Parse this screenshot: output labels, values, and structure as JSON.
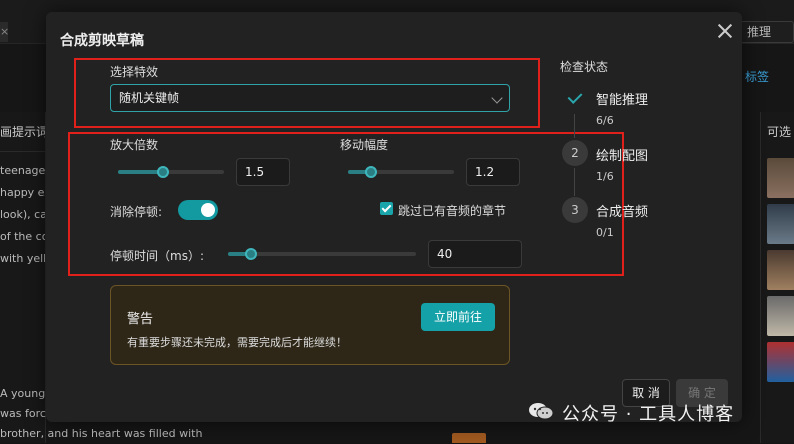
{
  "background": {
    "tab_left": "×",
    "btn_right": "推理",
    "link_right": "标签",
    "left_col": {
      "header": "画提示词",
      "lines": [
        "teenager",
        "happy ex",
        "look), cas",
        "of the co",
        "with yello"
      ]
    },
    "bottom_text": [
      "A young",
      "was force",
      "brother, and his heart was filled with"
    ],
    "right_col_header": "可选"
  },
  "modal": {
    "title": "合成剪映草稿",
    "effect": {
      "label": "选择特效",
      "value": "随机关键帧"
    },
    "zoom": {
      "label": "放大倍数",
      "value": "1.5",
      "fraction": 0.42
    },
    "move": {
      "label": "移动幅度",
      "value": "1.2",
      "fraction": 0.22
    },
    "remove_pause": {
      "label": "消除停顿:",
      "on": true
    },
    "skip_audio": {
      "label": "跳过已有音频的章节",
      "checked": true
    },
    "pause_time": {
      "label": "停顿时间（ms）:",
      "value": "40",
      "fraction": 0.12
    },
    "warning": {
      "title": "警告",
      "message": "有重要步骤还未完成，需要完成后才能继续！",
      "button": "立即前往"
    },
    "status": {
      "title": "检查状态",
      "steps": [
        {
          "icon": "",
          "name": "智能推理",
          "count": "6/6"
        },
        {
          "icon": "2",
          "name": "绘制配图",
          "count": "1/6"
        },
        {
          "icon": "3",
          "name": "合成音频",
          "count": "0/1"
        }
      ]
    },
    "cancel": "取 消",
    "confirm": "确 定"
  },
  "watermark": "公众号 · 工具人博客",
  "colors": {
    "accent": "#14a1a7",
    "highlight_box": "#e0201a",
    "warning_bg": "#2e2718"
  }
}
